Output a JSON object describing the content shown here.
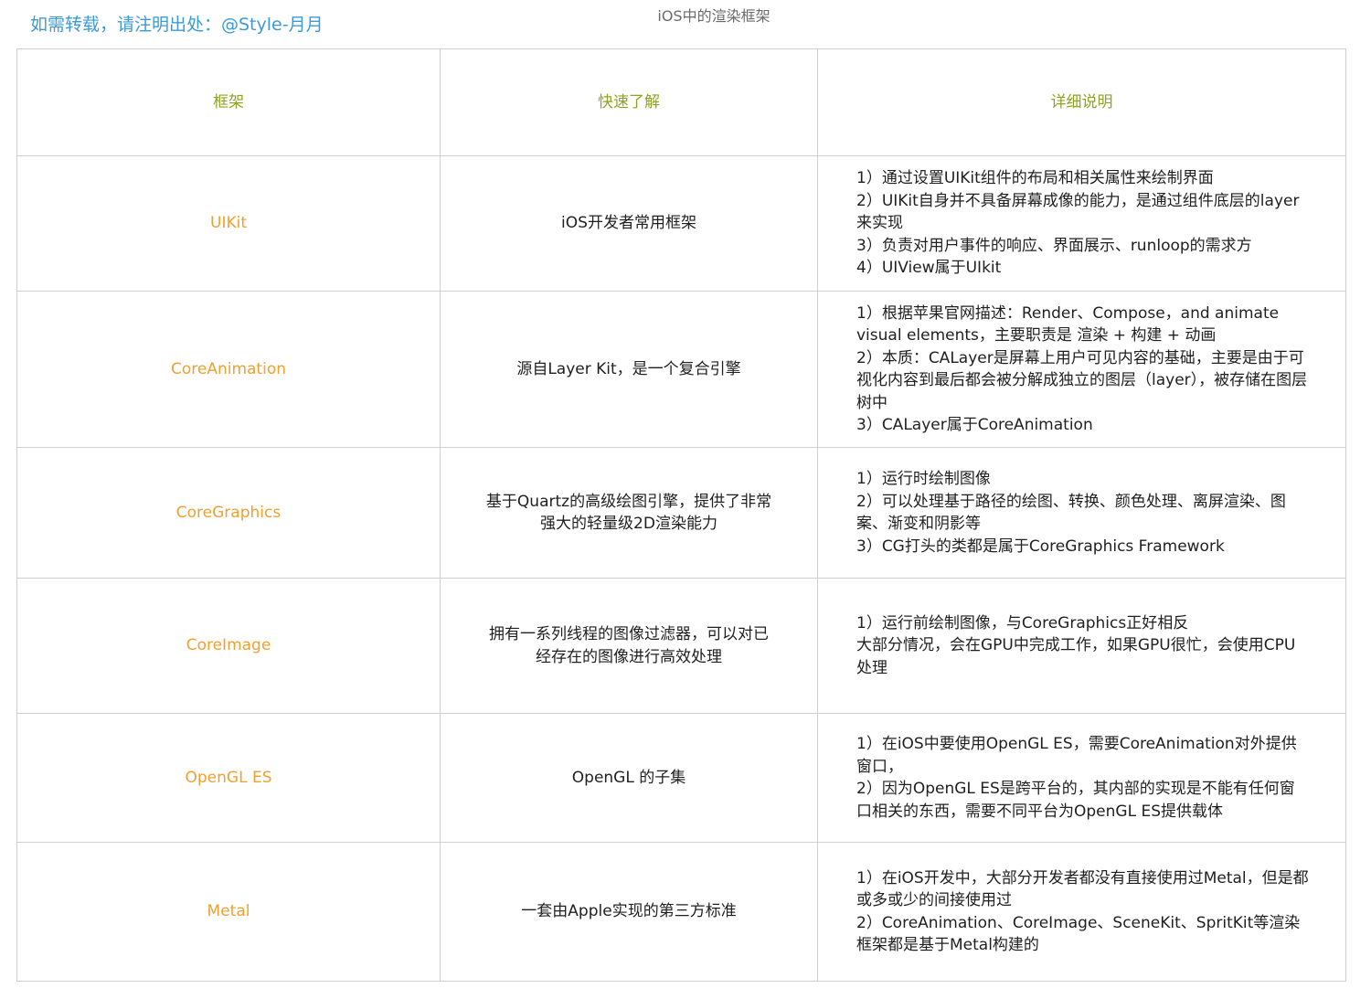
{
  "watermark": "如需转载，请注明出处：@Style-月月",
  "title": "iOS中的渲染框架",
  "table": {
    "headers": [
      "框架",
      "快速了解",
      "详细说明"
    ],
    "rows": [
      {
        "name": "UIKit",
        "summary": "iOS开发者常用框架",
        "details": [
          "1）通过设置UIKit组件的布局和相关属性来绘制界面",
          "2）UIKit自身并不具备屏幕成像的能力，是通过组件底层的layer来实现",
          "3）负责对用户事件的响应、界面展示、runloop的需求方",
          "4）UIView属于UIkit"
        ]
      },
      {
        "name": "CoreAnimation",
        "summary": "源自Layer Kit，是一个复合引擎",
        "details": [
          "1）根据苹果官网描述：Render、Compose，and animate visual elements，主要职责是 渲染 + 构建 + 动画",
          "2）本质：CALayer是屏幕上用户可见内容的基础，主要是由于可视化内容到最后都会被分解成独立的图层（layer），被存储在图层树中",
          "3）CALayer属于CoreAnimation"
        ]
      },
      {
        "name": "CoreGraphics",
        "summary": "基于Quartz的高级绘图引擎，提供了非常强大的轻量级2D渲染能力",
        "details": [
          "1）运行时绘制图像",
          "2）可以处理基于路径的绘图、转换、颜色处理、离屏渲染、图案、渐变和阴影等",
          "3）CG打头的类都是属于CoreGraphics Framework"
        ]
      },
      {
        "name": "CoreImage",
        "summary": "拥有一系列线程的图像过滤器，可以对已经存在的图像进行高效处理",
        "details": [
          "1）运行前绘制图像，与CoreGraphics正好相反",
          "大部分情况，会在GPU中完成工作，如果GPU很忙，会使用CPU处理"
        ]
      },
      {
        "name": "OpenGL ES",
        "summary": "OpenGL 的子集",
        "details": [
          "1）在iOS中要使用OpenGL ES，需要CoreAnimation对外提供窗口，",
          "2）因为OpenGL ES是跨平台的，其内部的实现是不能有任何窗口相关的东西，需要不同平台为OpenGL ES提供载体"
        ]
      },
      {
        "name": "Metal",
        "summary": "一套由Apple实现的第三方标准",
        "details": [
          "1）在iOS开发中，大部分开发者都没有直接使用过Metal，但是都或多或少的间接使用过",
          "2）CoreAnimation、CoreImage、SceneKit、SpritKit等渲染框架都是基于Metal构建的"
        ]
      }
    ]
  }
}
